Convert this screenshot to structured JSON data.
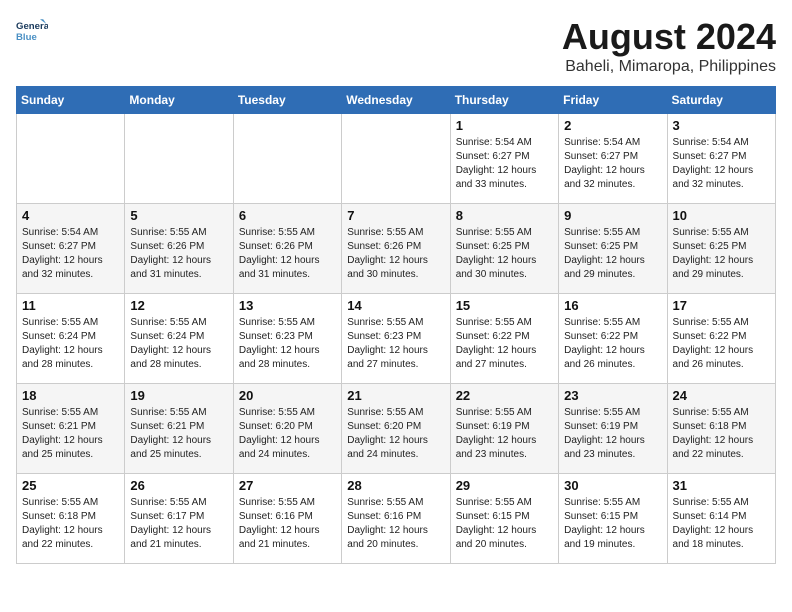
{
  "logo": {
    "line1": "General",
    "line2": "Blue"
  },
  "title": "August 2024",
  "location": "Baheli, Mimaropa, Philippines",
  "weekdays": [
    "Sunday",
    "Monday",
    "Tuesday",
    "Wednesday",
    "Thursday",
    "Friday",
    "Saturday"
  ],
  "weeks": [
    [
      {
        "day": "",
        "info": ""
      },
      {
        "day": "",
        "info": ""
      },
      {
        "day": "",
        "info": ""
      },
      {
        "day": "",
        "info": ""
      },
      {
        "day": "1",
        "info": "Sunrise: 5:54 AM\nSunset: 6:27 PM\nDaylight: 12 hours\nand 33 minutes."
      },
      {
        "day": "2",
        "info": "Sunrise: 5:54 AM\nSunset: 6:27 PM\nDaylight: 12 hours\nand 32 minutes."
      },
      {
        "day": "3",
        "info": "Sunrise: 5:54 AM\nSunset: 6:27 PM\nDaylight: 12 hours\nand 32 minutes."
      }
    ],
    [
      {
        "day": "4",
        "info": "Sunrise: 5:54 AM\nSunset: 6:27 PM\nDaylight: 12 hours\nand 32 minutes."
      },
      {
        "day": "5",
        "info": "Sunrise: 5:55 AM\nSunset: 6:26 PM\nDaylight: 12 hours\nand 31 minutes."
      },
      {
        "day": "6",
        "info": "Sunrise: 5:55 AM\nSunset: 6:26 PM\nDaylight: 12 hours\nand 31 minutes."
      },
      {
        "day": "7",
        "info": "Sunrise: 5:55 AM\nSunset: 6:26 PM\nDaylight: 12 hours\nand 30 minutes."
      },
      {
        "day": "8",
        "info": "Sunrise: 5:55 AM\nSunset: 6:25 PM\nDaylight: 12 hours\nand 30 minutes."
      },
      {
        "day": "9",
        "info": "Sunrise: 5:55 AM\nSunset: 6:25 PM\nDaylight: 12 hours\nand 29 minutes."
      },
      {
        "day": "10",
        "info": "Sunrise: 5:55 AM\nSunset: 6:25 PM\nDaylight: 12 hours\nand 29 minutes."
      }
    ],
    [
      {
        "day": "11",
        "info": "Sunrise: 5:55 AM\nSunset: 6:24 PM\nDaylight: 12 hours\nand 28 minutes."
      },
      {
        "day": "12",
        "info": "Sunrise: 5:55 AM\nSunset: 6:24 PM\nDaylight: 12 hours\nand 28 minutes."
      },
      {
        "day": "13",
        "info": "Sunrise: 5:55 AM\nSunset: 6:23 PM\nDaylight: 12 hours\nand 28 minutes."
      },
      {
        "day": "14",
        "info": "Sunrise: 5:55 AM\nSunset: 6:23 PM\nDaylight: 12 hours\nand 27 minutes."
      },
      {
        "day": "15",
        "info": "Sunrise: 5:55 AM\nSunset: 6:22 PM\nDaylight: 12 hours\nand 27 minutes."
      },
      {
        "day": "16",
        "info": "Sunrise: 5:55 AM\nSunset: 6:22 PM\nDaylight: 12 hours\nand 26 minutes."
      },
      {
        "day": "17",
        "info": "Sunrise: 5:55 AM\nSunset: 6:22 PM\nDaylight: 12 hours\nand 26 minutes."
      }
    ],
    [
      {
        "day": "18",
        "info": "Sunrise: 5:55 AM\nSunset: 6:21 PM\nDaylight: 12 hours\nand 25 minutes."
      },
      {
        "day": "19",
        "info": "Sunrise: 5:55 AM\nSunset: 6:21 PM\nDaylight: 12 hours\nand 25 minutes."
      },
      {
        "day": "20",
        "info": "Sunrise: 5:55 AM\nSunset: 6:20 PM\nDaylight: 12 hours\nand 24 minutes."
      },
      {
        "day": "21",
        "info": "Sunrise: 5:55 AM\nSunset: 6:20 PM\nDaylight: 12 hours\nand 24 minutes."
      },
      {
        "day": "22",
        "info": "Sunrise: 5:55 AM\nSunset: 6:19 PM\nDaylight: 12 hours\nand 23 minutes."
      },
      {
        "day": "23",
        "info": "Sunrise: 5:55 AM\nSunset: 6:19 PM\nDaylight: 12 hours\nand 23 minutes."
      },
      {
        "day": "24",
        "info": "Sunrise: 5:55 AM\nSunset: 6:18 PM\nDaylight: 12 hours\nand 22 minutes."
      }
    ],
    [
      {
        "day": "25",
        "info": "Sunrise: 5:55 AM\nSunset: 6:18 PM\nDaylight: 12 hours\nand 22 minutes."
      },
      {
        "day": "26",
        "info": "Sunrise: 5:55 AM\nSunset: 6:17 PM\nDaylight: 12 hours\nand 21 minutes."
      },
      {
        "day": "27",
        "info": "Sunrise: 5:55 AM\nSunset: 6:16 PM\nDaylight: 12 hours\nand 21 minutes."
      },
      {
        "day": "28",
        "info": "Sunrise: 5:55 AM\nSunset: 6:16 PM\nDaylight: 12 hours\nand 20 minutes."
      },
      {
        "day": "29",
        "info": "Sunrise: 5:55 AM\nSunset: 6:15 PM\nDaylight: 12 hours\nand 20 minutes."
      },
      {
        "day": "30",
        "info": "Sunrise: 5:55 AM\nSunset: 6:15 PM\nDaylight: 12 hours\nand 19 minutes."
      },
      {
        "day": "31",
        "info": "Sunrise: 5:55 AM\nSunset: 6:14 PM\nDaylight: 12 hours\nand 18 minutes."
      }
    ]
  ]
}
